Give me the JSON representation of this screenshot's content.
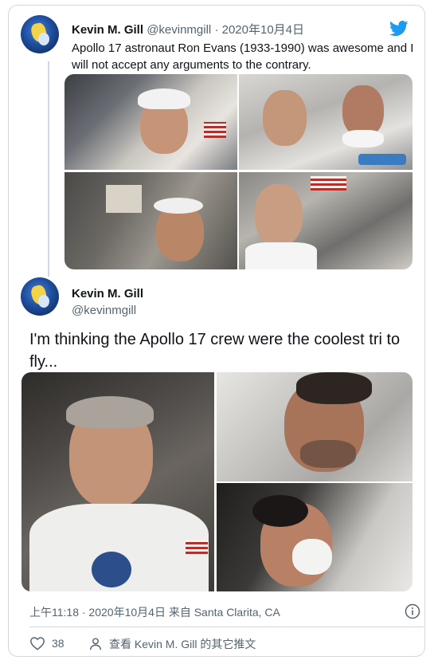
{
  "quoted_tweet": {
    "author_name": "Kevin M. Gill",
    "author_handle": "@kevinmgill",
    "separator": "·",
    "date": "2020年10月4日",
    "text": "Apollo 17 astronaut Ron Evans (1933-1990) was awesome and I will not accept any arguments to the contrary."
  },
  "main_tweet": {
    "author_name": "Kevin M. Gill",
    "author_handle": "@kevinmgill",
    "text": "I'm thinking the Apollo 17 crew were the coolest tri to fly..."
  },
  "meta": {
    "time": "上午11:18 · 2020年10月4日 来自 Santa Clarita, CA"
  },
  "actions": {
    "like_count": "38",
    "profile_link": "查看 Kevin M. Gill 的其它推文"
  },
  "colors": {
    "twitter_blue": "#1d9bf0",
    "border": "#cfd9de",
    "secondary_text": "#536471"
  },
  "icons": [
    "twitter-logo-icon",
    "info-icon",
    "heart-icon",
    "person-icon"
  ]
}
